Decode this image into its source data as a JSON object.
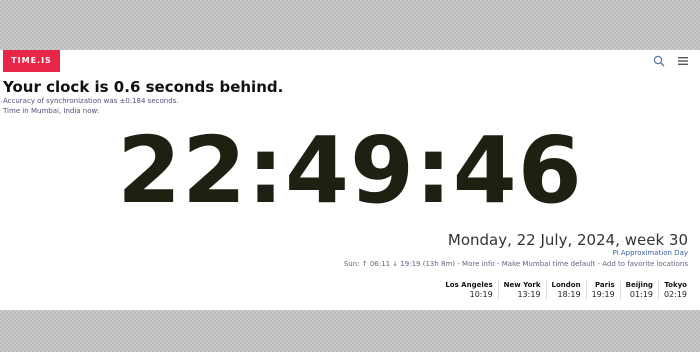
{
  "brand": {
    "logo": "TIME.IS",
    "color": "#e8264a"
  },
  "header": {
    "icons": [
      "search-icon",
      "menu-icon"
    ]
  },
  "status": {
    "headline": "Your clock is 0.6 seconds behind.",
    "accuracy": "Accuracy of synchronization was ±0.184 seconds.",
    "location_label": "Time in Mumbai, India now:"
  },
  "clock": {
    "time": "22:49:46"
  },
  "date": {
    "full": "Monday, 22 July, 2024, week 30",
    "observance": "Pi Approximation Day"
  },
  "sun": {
    "text": "Sun: ↑ 06:11 ↓ 19:19 (13h 8m)",
    "more_info": "More info",
    "make_default": "Make Mumbai time default",
    "add_favorite": "Add to favorite locations",
    "separator": " - "
  },
  "cities": [
    {
      "name": "Los Angeles",
      "time": "10:19"
    },
    {
      "name": "New York",
      "time": "13:19"
    },
    {
      "name": "London",
      "time": "18:19"
    },
    {
      "name": "Paris",
      "time": "19:19"
    },
    {
      "name": "Beijing",
      "time": "01:19"
    },
    {
      "name": "Tokyo",
      "time": "02:19"
    }
  ]
}
